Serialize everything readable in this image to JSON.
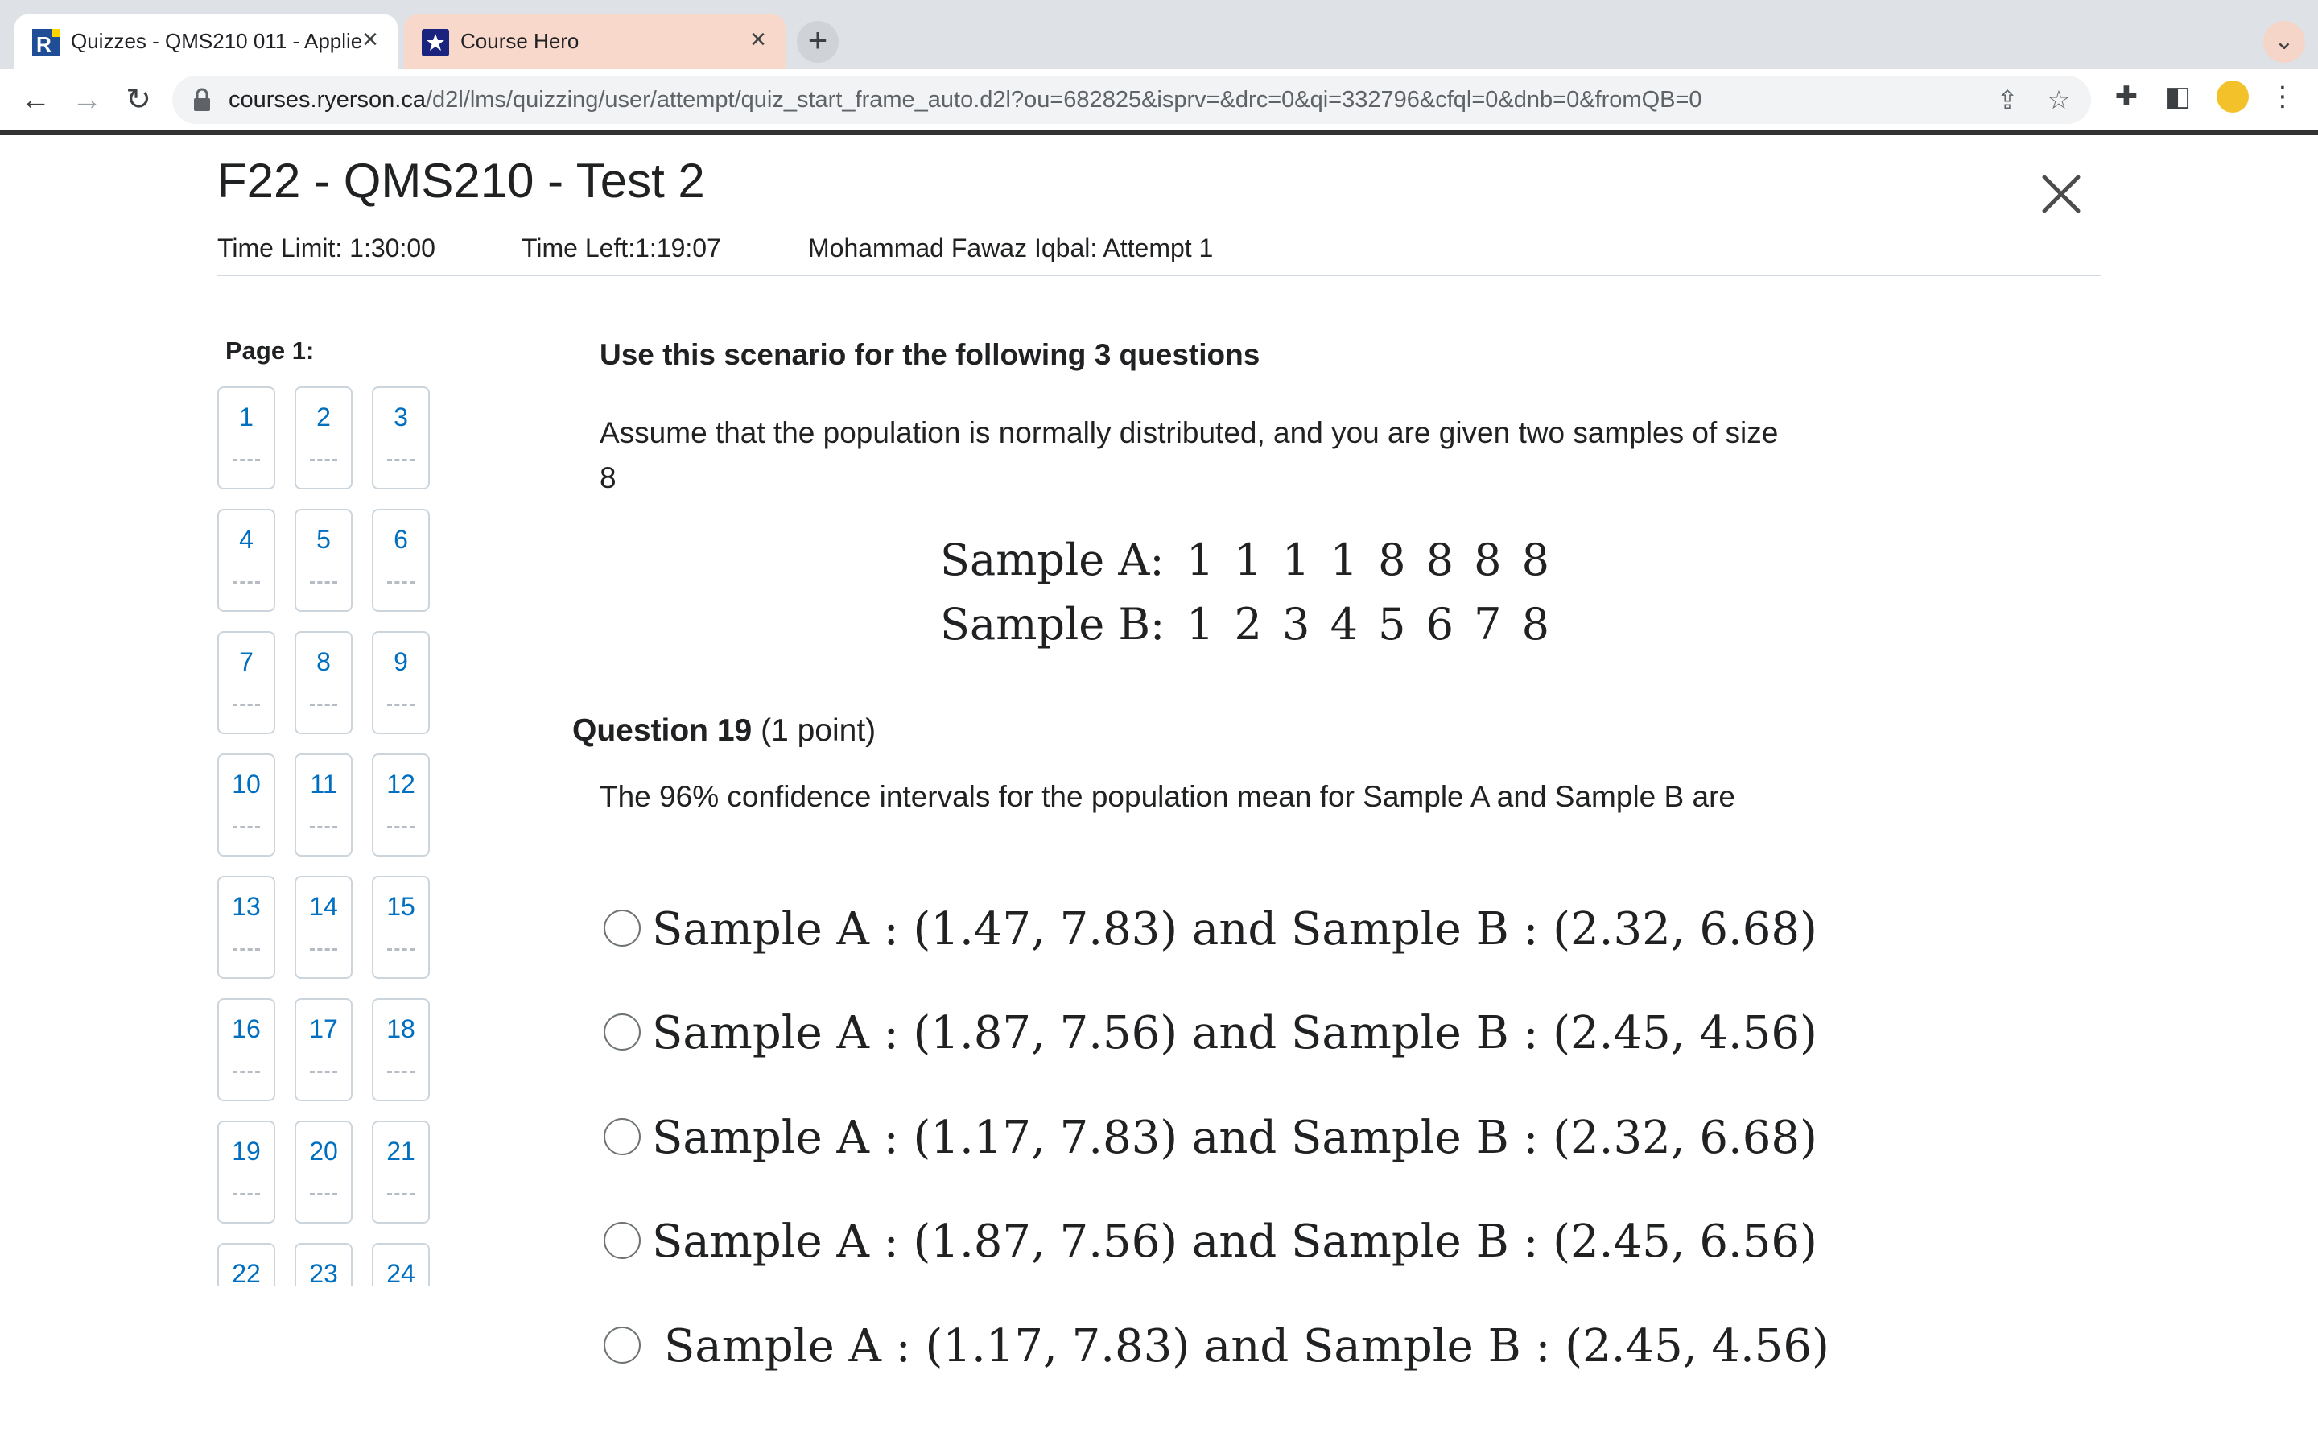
{
  "browser": {
    "tabs": [
      {
        "title": "Quizzes - QMS210 011 - Applie",
        "active": true
      },
      {
        "title": "Course Hero",
        "active": false
      }
    ],
    "url_host": "courses.ryerson.ca",
    "url_path": "/d2l/lms/quizzing/user/attempt/quiz_start_frame_auto.d2l?ou=682825&isprv=&drc=0&qi=332796&cfql=0&dnb=0&fromQB=0"
  },
  "quiz": {
    "title": "F22 - QMS210 - Test 2",
    "time_limit": "Time Limit: 1:30:00",
    "time_left": "Time Left:1:19:07",
    "attempt": "Mohammad Fawaz Iqbal: Attempt 1"
  },
  "nav": {
    "page_label": "Page 1:",
    "questions": [
      "1",
      "2",
      "3",
      "4",
      "5",
      "6",
      "7",
      "8",
      "9",
      "10",
      "11",
      "12",
      "13",
      "14",
      "15",
      "16",
      "17",
      "18",
      "19",
      "20",
      "21",
      "22",
      "23",
      "24"
    ]
  },
  "scenario": {
    "title": "Use this scenario for the following 3 questions",
    "text": "Assume that the population is normally distributed, and you are given two samples of size 8",
    "sample_a_label": "Sample A:",
    "sample_a_values": "1 1 1 1 8 8 8 8",
    "sample_b_label": "Sample B:",
    "sample_b_values": "1 2 3 4 5 6 7 8"
  },
  "question": {
    "number": "Question 19",
    "points": "(1 point)",
    "text": "The 96% confidence intervals for the population mean for Sample A and Sample B are",
    "options": [
      "Sample A : (1.47,  7.83) and Sample B : (2.32,  6.68)",
      "Sample A : (1.87,  7.56) and Sample B : (2.45,  4.56)",
      "Sample A : (1.17,  7.83) and Sample B : (2.32,  6.68)",
      "Sample A : (1.87,  7.56) and Sample B : (2.45,  6.56)",
      "Sample A : (1.17,  7.83) and Sample B : (2.45,  4.56)"
    ]
  },
  "colors": {
    "link_blue": "#006fbf",
    "tab_inactive": "#f9d8cc",
    "course_hero_blue": "#1a237e"
  }
}
